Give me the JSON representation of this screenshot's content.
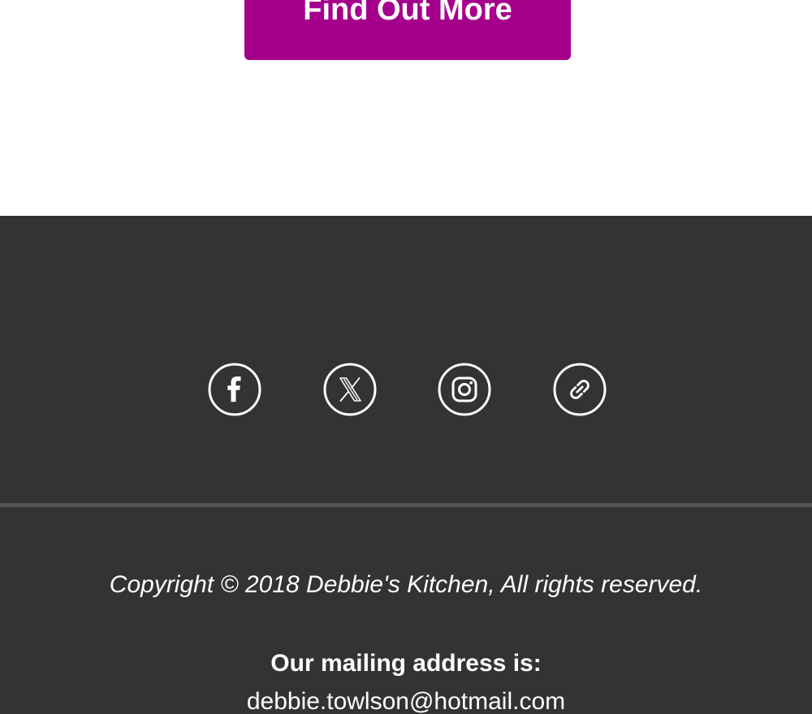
{
  "cta": {
    "label": "Find Out More"
  },
  "colors": {
    "cta_background": "#a5008c",
    "footer_background": "#333333",
    "divider": "#555555",
    "footer_text": "#ffffff"
  },
  "social": {
    "items": [
      {
        "icon": "facebook-icon"
      },
      {
        "icon": "x-twitter-icon"
      },
      {
        "icon": "instagram-icon"
      },
      {
        "icon": "website-link-icon"
      }
    ]
  },
  "footer": {
    "copyright": "Copyright © 2018 Debbie's Kitchen, All rights reserved.",
    "address_heading": "Our mailing address is:",
    "address_email": "debbie.towlson@hotmail.com"
  }
}
